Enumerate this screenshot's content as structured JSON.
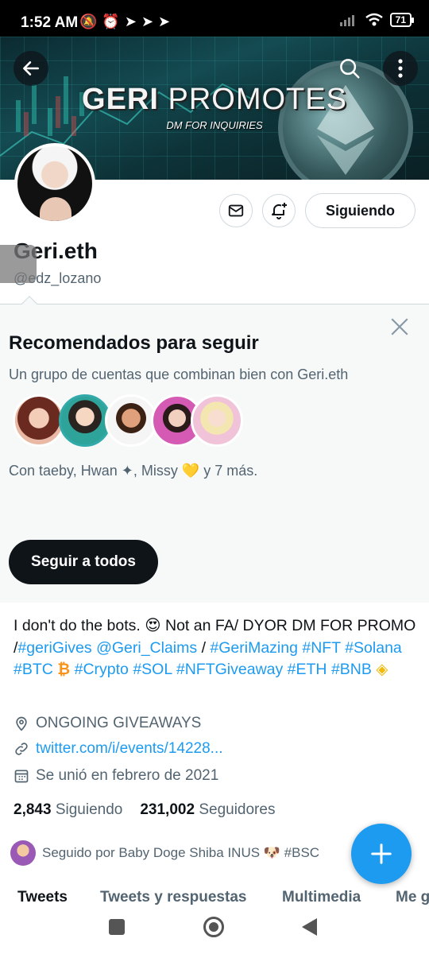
{
  "status_bar": {
    "time": "1:52 AM",
    "battery": "71"
  },
  "banner": {
    "title_bold": "GERI",
    "title_light": "PROMOTES",
    "subtitle": "DM FOR INQUIRIES"
  },
  "profile": {
    "name": "Geri.eth",
    "handle": "@edz_lozano",
    "following_button": "Siguiendo"
  },
  "recommendations": {
    "title": "Recomendados para seguir",
    "description": "Un grupo de cuentas que combinan bien con Geri.eth",
    "followed_text": "Con taeby, Hwan ✦, Missy 💛 y 7 más.",
    "follow_all_button": "Seguir a todos"
  },
  "bio": {
    "line1_text": "I don't do the bots. 😍 Not an FA/ DYOR DM FOR PROMO /",
    "tag_gerigives": "#geriGives",
    "mention_claims": "@Geri_Claims",
    "sep": "/",
    "tag_gerimazing": "#GeriMazing",
    "tag_nft": "#NFT",
    "tag_solana": "#Solana",
    "tag_btc": "#BTC",
    "btc_emoji": "₿",
    "tag_crypto": "#Crypto",
    "tag_sol": "#SOL",
    "tag_nftgiveaway": "#NFTGiveaway",
    "tag_eth": "#ETH",
    "tag_bnb": "#BNB",
    "bnb_emoji": "◈"
  },
  "meta": {
    "location": "ONGOING GIVEAWAYS",
    "url": "twitter.com/i/events/14228...",
    "joined": "Se unió en febrero de 2021"
  },
  "stats": {
    "following_count": "2,843",
    "following_label": "Siguiendo",
    "followers_count": "231,002",
    "followers_label": "Seguidores"
  },
  "followed_by": "Seguido por Baby Doge Shiba INUS 🐶 #BSC",
  "tabs": [
    "Tweets",
    "Tweets y respuestas",
    "Multimedia",
    "Me gusta"
  ],
  "colors": {
    "accent": "#1d9bf0",
    "text": "#0f1419",
    "muted": "#536471"
  }
}
